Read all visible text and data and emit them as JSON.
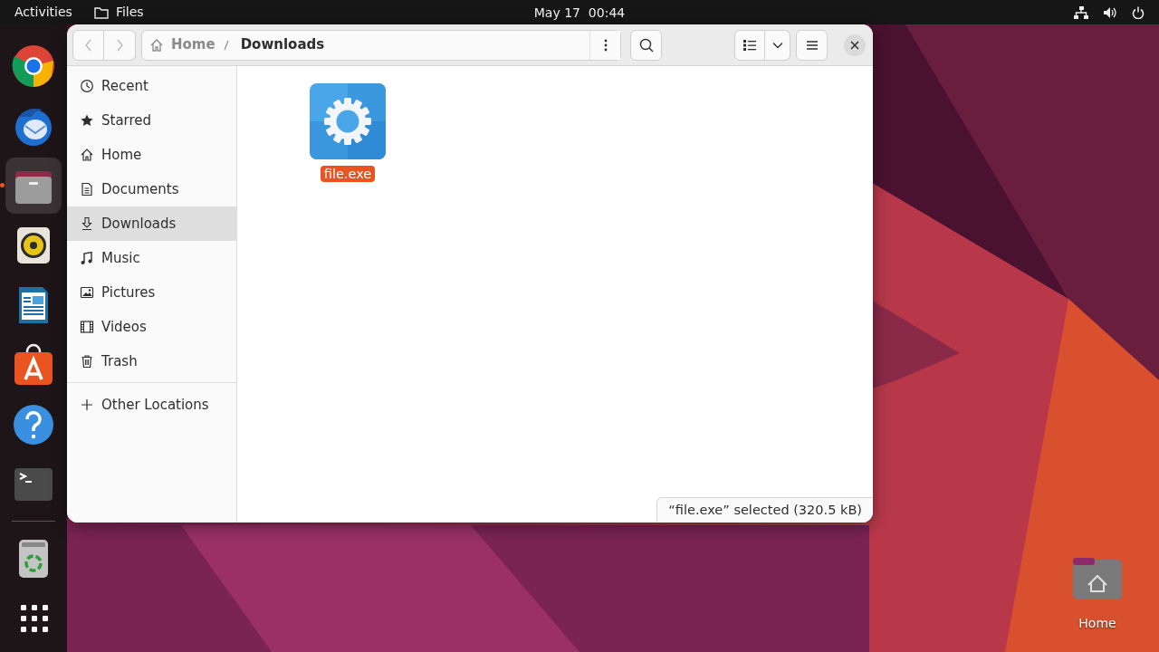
{
  "top_bar": {
    "activities": "Activities",
    "app": "Files",
    "clock": "May 17  00:44"
  },
  "dock": [
    {
      "kind": "chrome",
      "running": false
    },
    {
      "kind": "thunderbird",
      "running": false
    },
    {
      "kind": "files",
      "running": true
    },
    {
      "kind": "rhythmbox",
      "running": false
    },
    {
      "kind": "writer",
      "running": false
    },
    {
      "kind": "appcenter",
      "running": false
    },
    {
      "kind": "help",
      "running": false
    },
    {
      "kind": "terminal",
      "running": false
    },
    {
      "kind": "separator"
    },
    {
      "kind": "trash",
      "running": false
    },
    {
      "kind": "grid",
      "running": false
    }
  ],
  "window": {
    "nav_buttons": [
      {
        "kind": "back",
        "disabled": true
      },
      {
        "kind": "forward",
        "disabled": true
      }
    ],
    "breadcrumb": [
      {
        "label": "Home",
        "selected": false
      },
      {
        "label": "Downloads",
        "selected": true
      }
    ],
    "sidebar": [
      {
        "kind": "recent",
        "label": "Recent",
        "selected": false
      },
      {
        "kind": "starred",
        "label": "Starred",
        "selected": false
      },
      {
        "kind": "home",
        "label": "Home",
        "selected": false
      },
      {
        "kind": "documents",
        "label": "Documents",
        "selected": false
      },
      {
        "kind": "downloads",
        "label": "Downloads",
        "selected": true
      },
      {
        "kind": "music",
        "label": "Music",
        "selected": false
      },
      {
        "kind": "pictures",
        "label": "Pictures",
        "selected": false
      },
      {
        "kind": "videos",
        "label": "Videos",
        "selected": false
      },
      {
        "kind": "trash",
        "label": "Trash",
        "selected": false
      },
      {
        "kind": "other",
        "label": "Other Locations",
        "selected": false
      }
    ],
    "files": [
      {
        "name": "file.exe",
        "kind": "executable",
        "selected": true
      }
    ],
    "status": "“file.exe” selected (320.5 kB)"
  },
  "desktop_icons": [
    {
      "kind": "home-folder",
      "label": "Home"
    }
  ]
}
